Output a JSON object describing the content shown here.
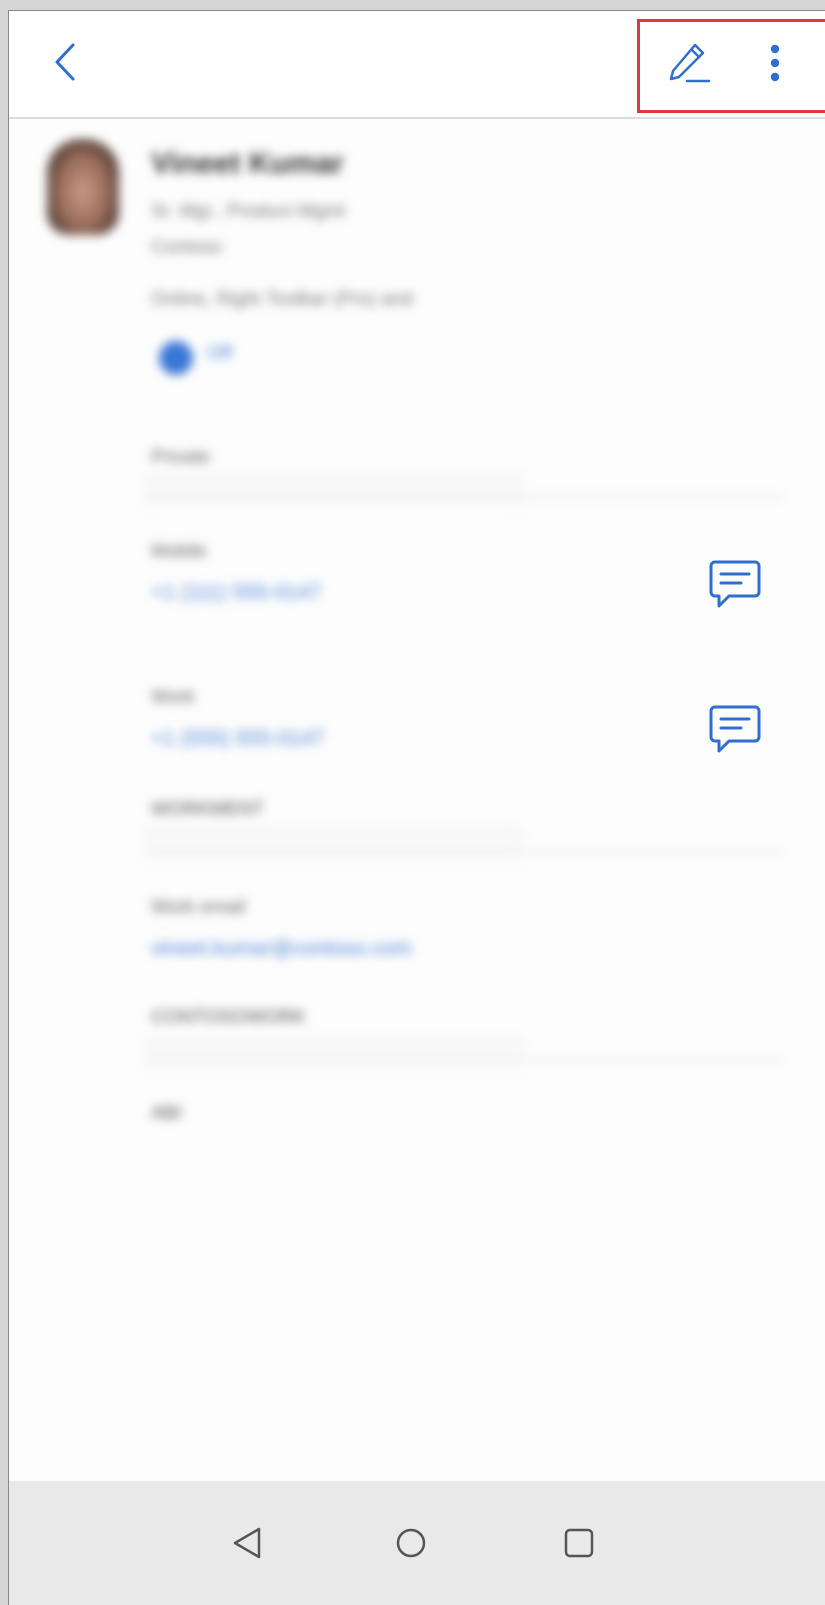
{
  "appbar": {
    "back_icon": "chevron-left-icon",
    "edit_icon": "pencil-icon",
    "more_icon": "more-vertical-icon",
    "accent_color": "#2f6fd0",
    "highlight_color": "#e2373c"
  },
  "profile": {
    "name": "Vineet Kumar",
    "line1": "Sr. Mgr., Product Mgmt",
    "line2": "Contoso",
    "line3": "Online, Right Toolbar (Pro) and",
    "presence_label": "Off",
    "presence_color": "#3a77d6"
  },
  "fields": [
    {
      "label": "Private",
      "value": ""
    },
    {
      "label": "Mobile",
      "value": "+1 (111) 555-0147"
    },
    {
      "label": "Work",
      "value": "+1 (555) 555-0147"
    },
    {
      "label": "WORKMENT",
      "value": ""
    },
    {
      "label": "Work email",
      "value": "vineet.kumar@contoso.com"
    },
    {
      "label": "CONTOSOWORK",
      "value": ""
    },
    {
      "label": "ABI",
      "value": ""
    }
  ],
  "chat_icon": "chat-bubble-icon",
  "navbar": {
    "back_icon": "triangle-back-icon",
    "home_icon": "circle-home-icon",
    "recents_icon": "square-recents-icon"
  }
}
